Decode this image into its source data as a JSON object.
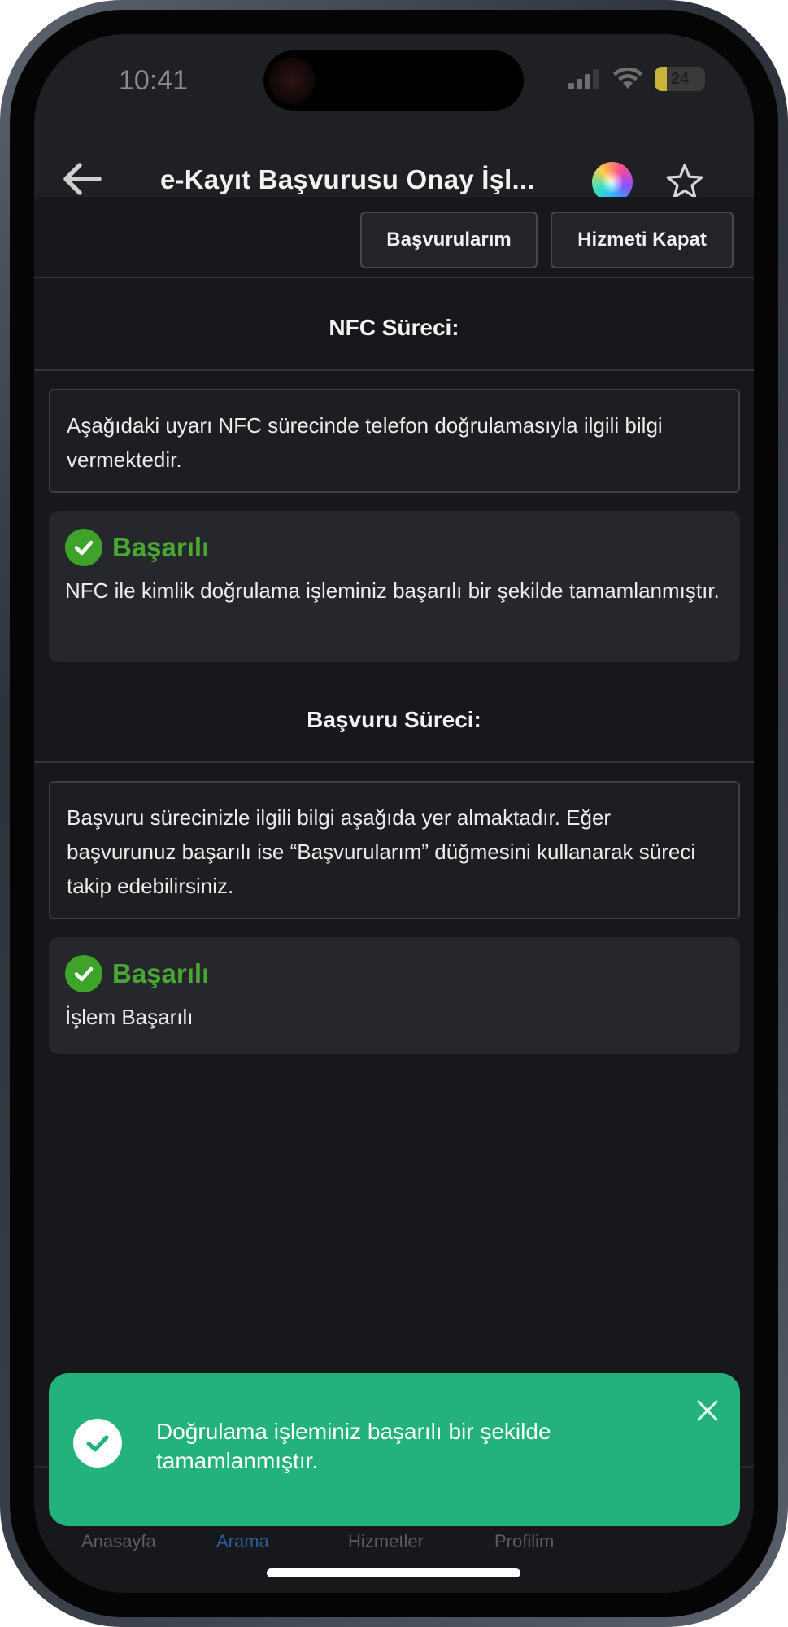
{
  "status_bar": {
    "time": "10:41",
    "battery_percent": "24",
    "battery_level": 0.24,
    "signal_icon": "signal-bars-icon",
    "wifi_icon": "wifi-icon"
  },
  "header": {
    "title": "e-Kayıt Başvurusu Onay İşl...",
    "back_icon": "arrow-left-icon",
    "assistant_icon": "siri-icon",
    "favorite_icon": "star-outline-icon"
  },
  "actions": {
    "applications_label": "Başvurularım",
    "close_service_label": "Hizmeti Kapat"
  },
  "nfc_section": {
    "title": "NFC Süreci:",
    "info_text": "Aşağıdaki uyarı NFC sürecinde telefon doğrulamasıyla ilgili bilgi vermektedir.",
    "status_title": "Başarılı",
    "status_text": "NFC ile kimlik doğrulama işleminiz başarılı bir şekilde tamamlanmıştır."
  },
  "application_section": {
    "title": "Başvuru Süreci:",
    "info_text": "Başvuru sürecinizle ilgili bilgi aşağıda yer almaktadır. Eğer başvurunuz başarılı ise “Başvurularım” düğmesini kullanarak süreci takip edebilirsiniz.",
    "status_title": "Başarılı",
    "status_text": "İşlem Başarılı"
  },
  "toast": {
    "message": "Doğrulama işleminiz başarılı bir şekilde tamamlanmıştır.",
    "color": "#23b27b"
  },
  "tab_bar": {
    "items": [
      {
        "label": "Anasayfa",
        "active": false
      },
      {
        "label": "Arama",
        "active": true
      },
      {
        "label": "Hizmetler",
        "active": false
      },
      {
        "label": "Profilim",
        "active": false
      }
    ]
  },
  "colors": {
    "success_green": "#48a832",
    "background": "#17181b",
    "card": "#25272c"
  }
}
